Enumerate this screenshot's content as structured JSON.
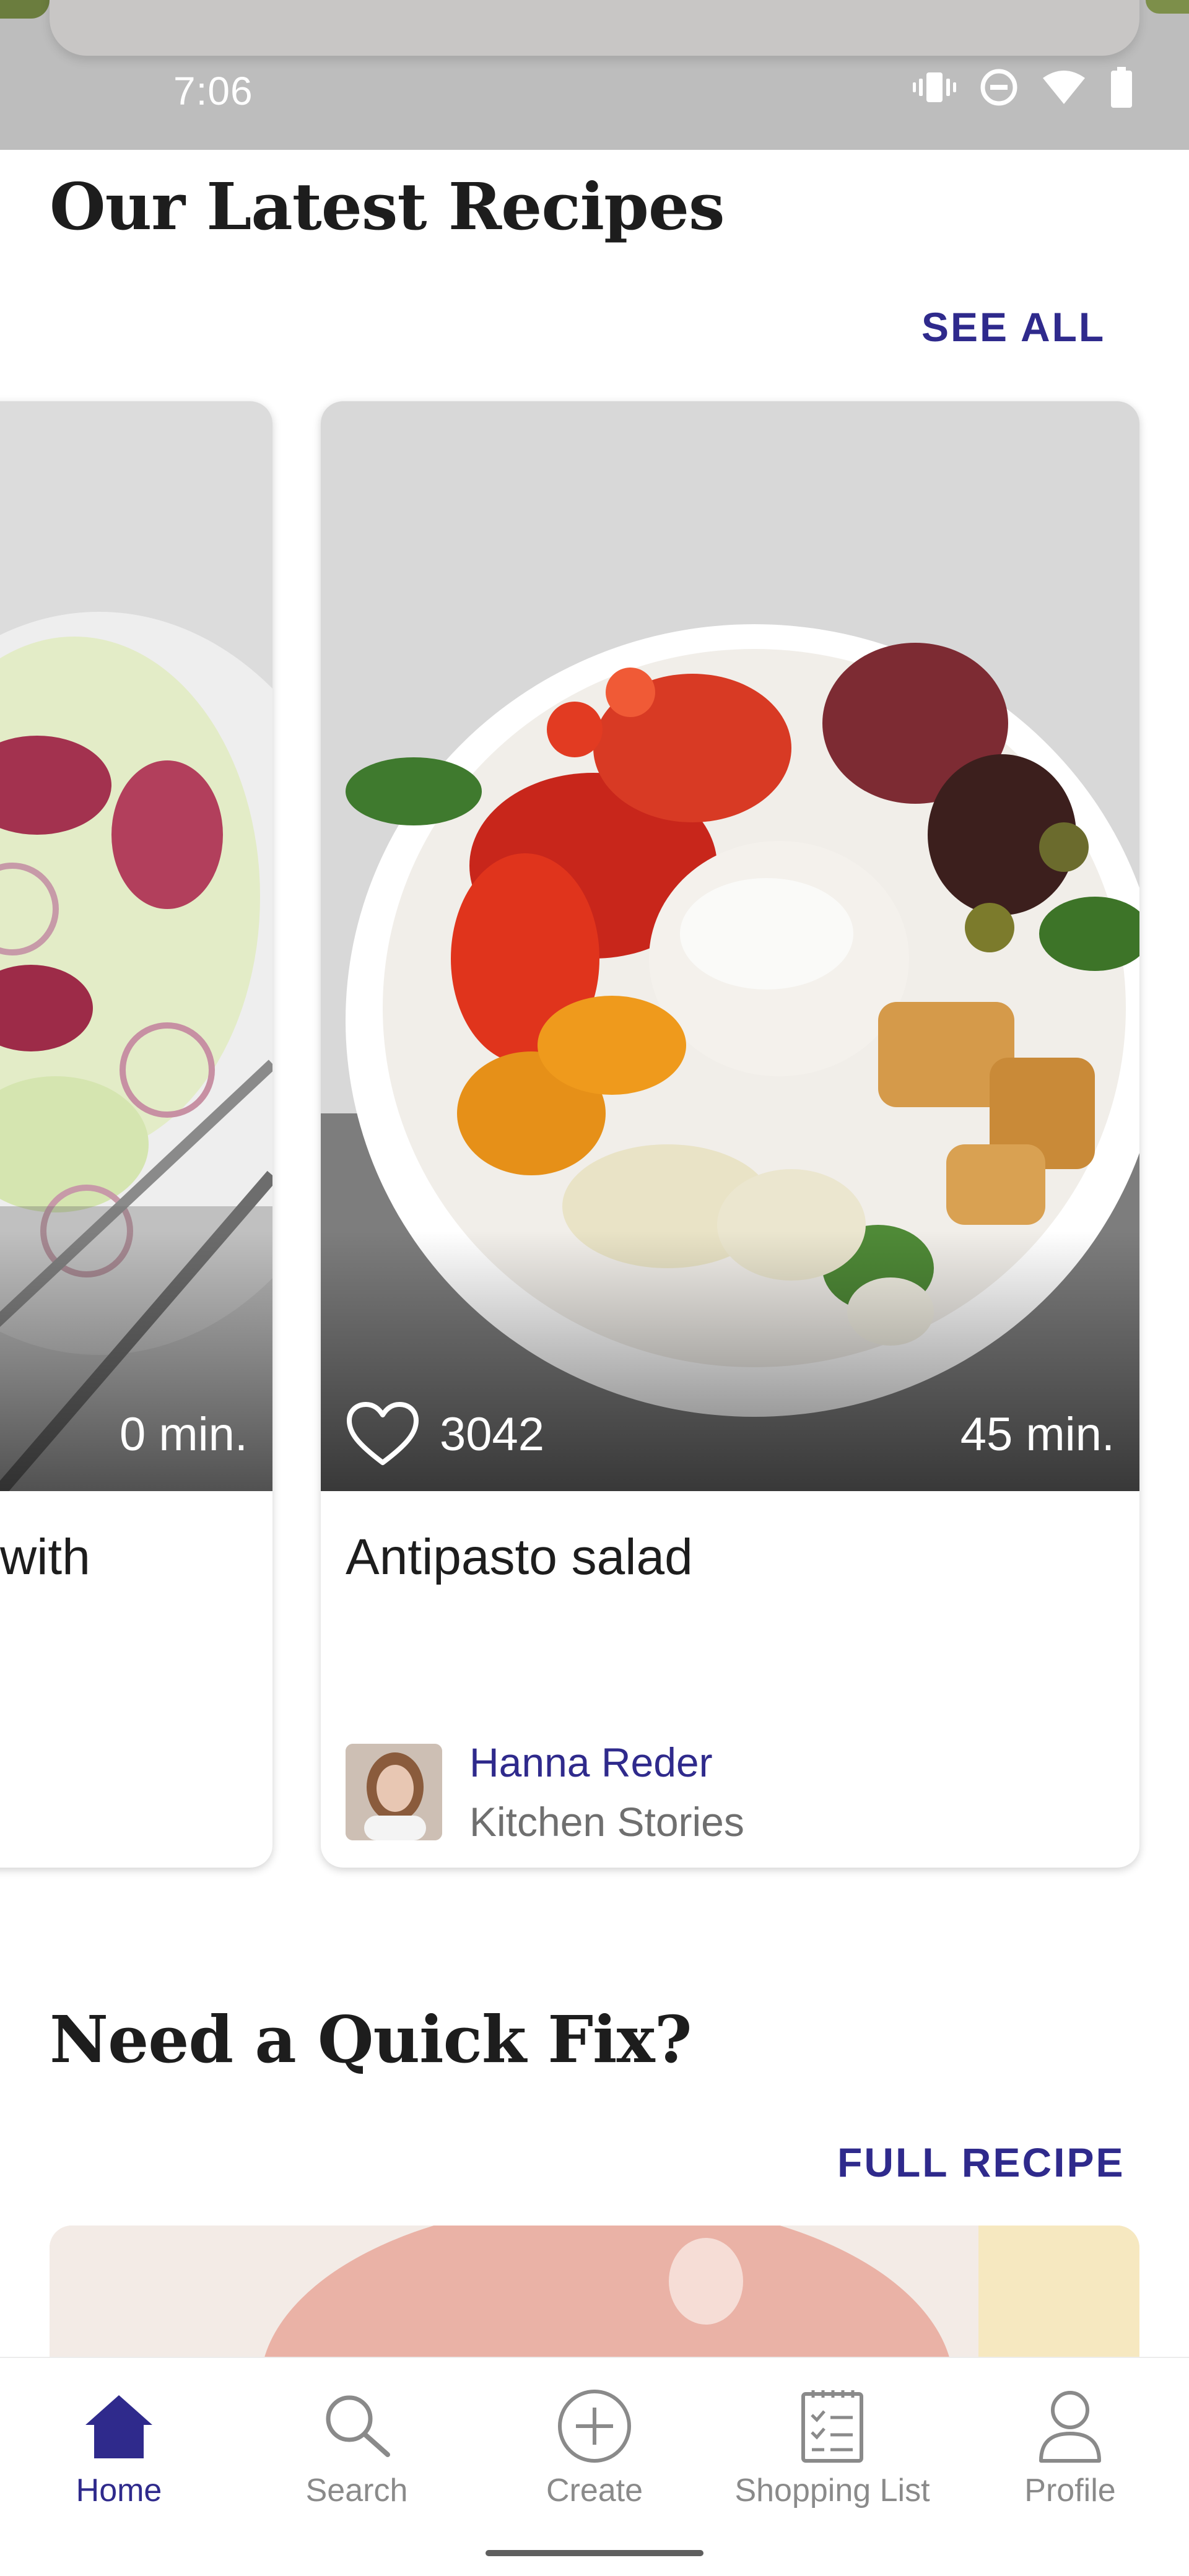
{
  "status_bar": {
    "time": "7:06",
    "icons": [
      "vibrate-icon",
      "do-not-disturb-icon",
      "wifi-icon",
      "battery-icon"
    ]
  },
  "latest": {
    "title": "Our Latest Recipes",
    "see_all": "SEE ALL",
    "cards": [
      {
        "title": "with",
        "duration": "0 min."
      },
      {
        "title": "Antipasto salad",
        "likes": "3042",
        "duration": "45 min.",
        "author_name": "Hanna Reder",
        "author_source": "Kitchen Stories"
      }
    ]
  },
  "quick_fix": {
    "title": "Need a Quick Fix?",
    "link": "FULL RECIPE"
  },
  "bottom_nav": {
    "active": "Home",
    "items": [
      {
        "label": "Home",
        "icon": "home-icon"
      },
      {
        "label": "Search",
        "icon": "search-icon"
      },
      {
        "label": "Create",
        "icon": "plus-circle-icon"
      },
      {
        "label": "Shopping List",
        "icon": "checklist-icon"
      },
      {
        "label": "Profile",
        "icon": "person-icon"
      }
    ]
  },
  "colors": {
    "accent": "#2f2a8c",
    "status_bar": "#bdbdbd",
    "inactive": "#8a8a8a"
  }
}
